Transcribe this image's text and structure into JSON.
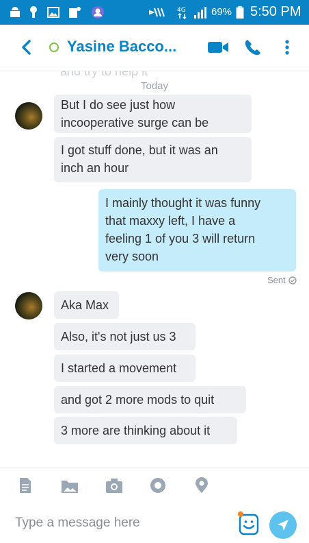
{
  "status_bar": {
    "battery_percent": "69%",
    "time": "5:50 PM",
    "colors": {
      "background": "#0a84c6",
      "foreground": "#ffffff"
    },
    "icons": [
      "android-icon",
      "notification-icon",
      "image-icon",
      "app-icon",
      "profile-icon",
      "mute-icon",
      "data-icon",
      "signal-icon",
      "battery-icon"
    ]
  },
  "header": {
    "contact_name": "Yasine Bacco...",
    "presence_status": "online",
    "accent_color": "#0a84c6"
  },
  "conversation": {
    "faded_text": "and try to help it",
    "date_separator": "Today",
    "group1": {
      "messages": [
        "But I do see just how\nincooperative surge can be",
        "I got stuff done, but it was an\ninch an hour"
      ]
    },
    "outgoing": {
      "text": "I mainly thought it was funny\nthat maxxy left, I have a\nfeeling 1 of you 3 will return\nvery soon",
      "status": "Sent"
    },
    "group2": {
      "messages": [
        "Aka Max",
        "Also, it's not just us 3",
        "I started a movement",
        "and got 2 more mods to quit",
        "3 more are thinking about it"
      ]
    },
    "colors": {
      "incoming_bubble": "#eeeff3",
      "outgoing_bubble": "#c5ecfb"
    }
  },
  "composer": {
    "placeholder": "Type a message here",
    "value": "",
    "send_button_color": "#5ec2ef"
  }
}
